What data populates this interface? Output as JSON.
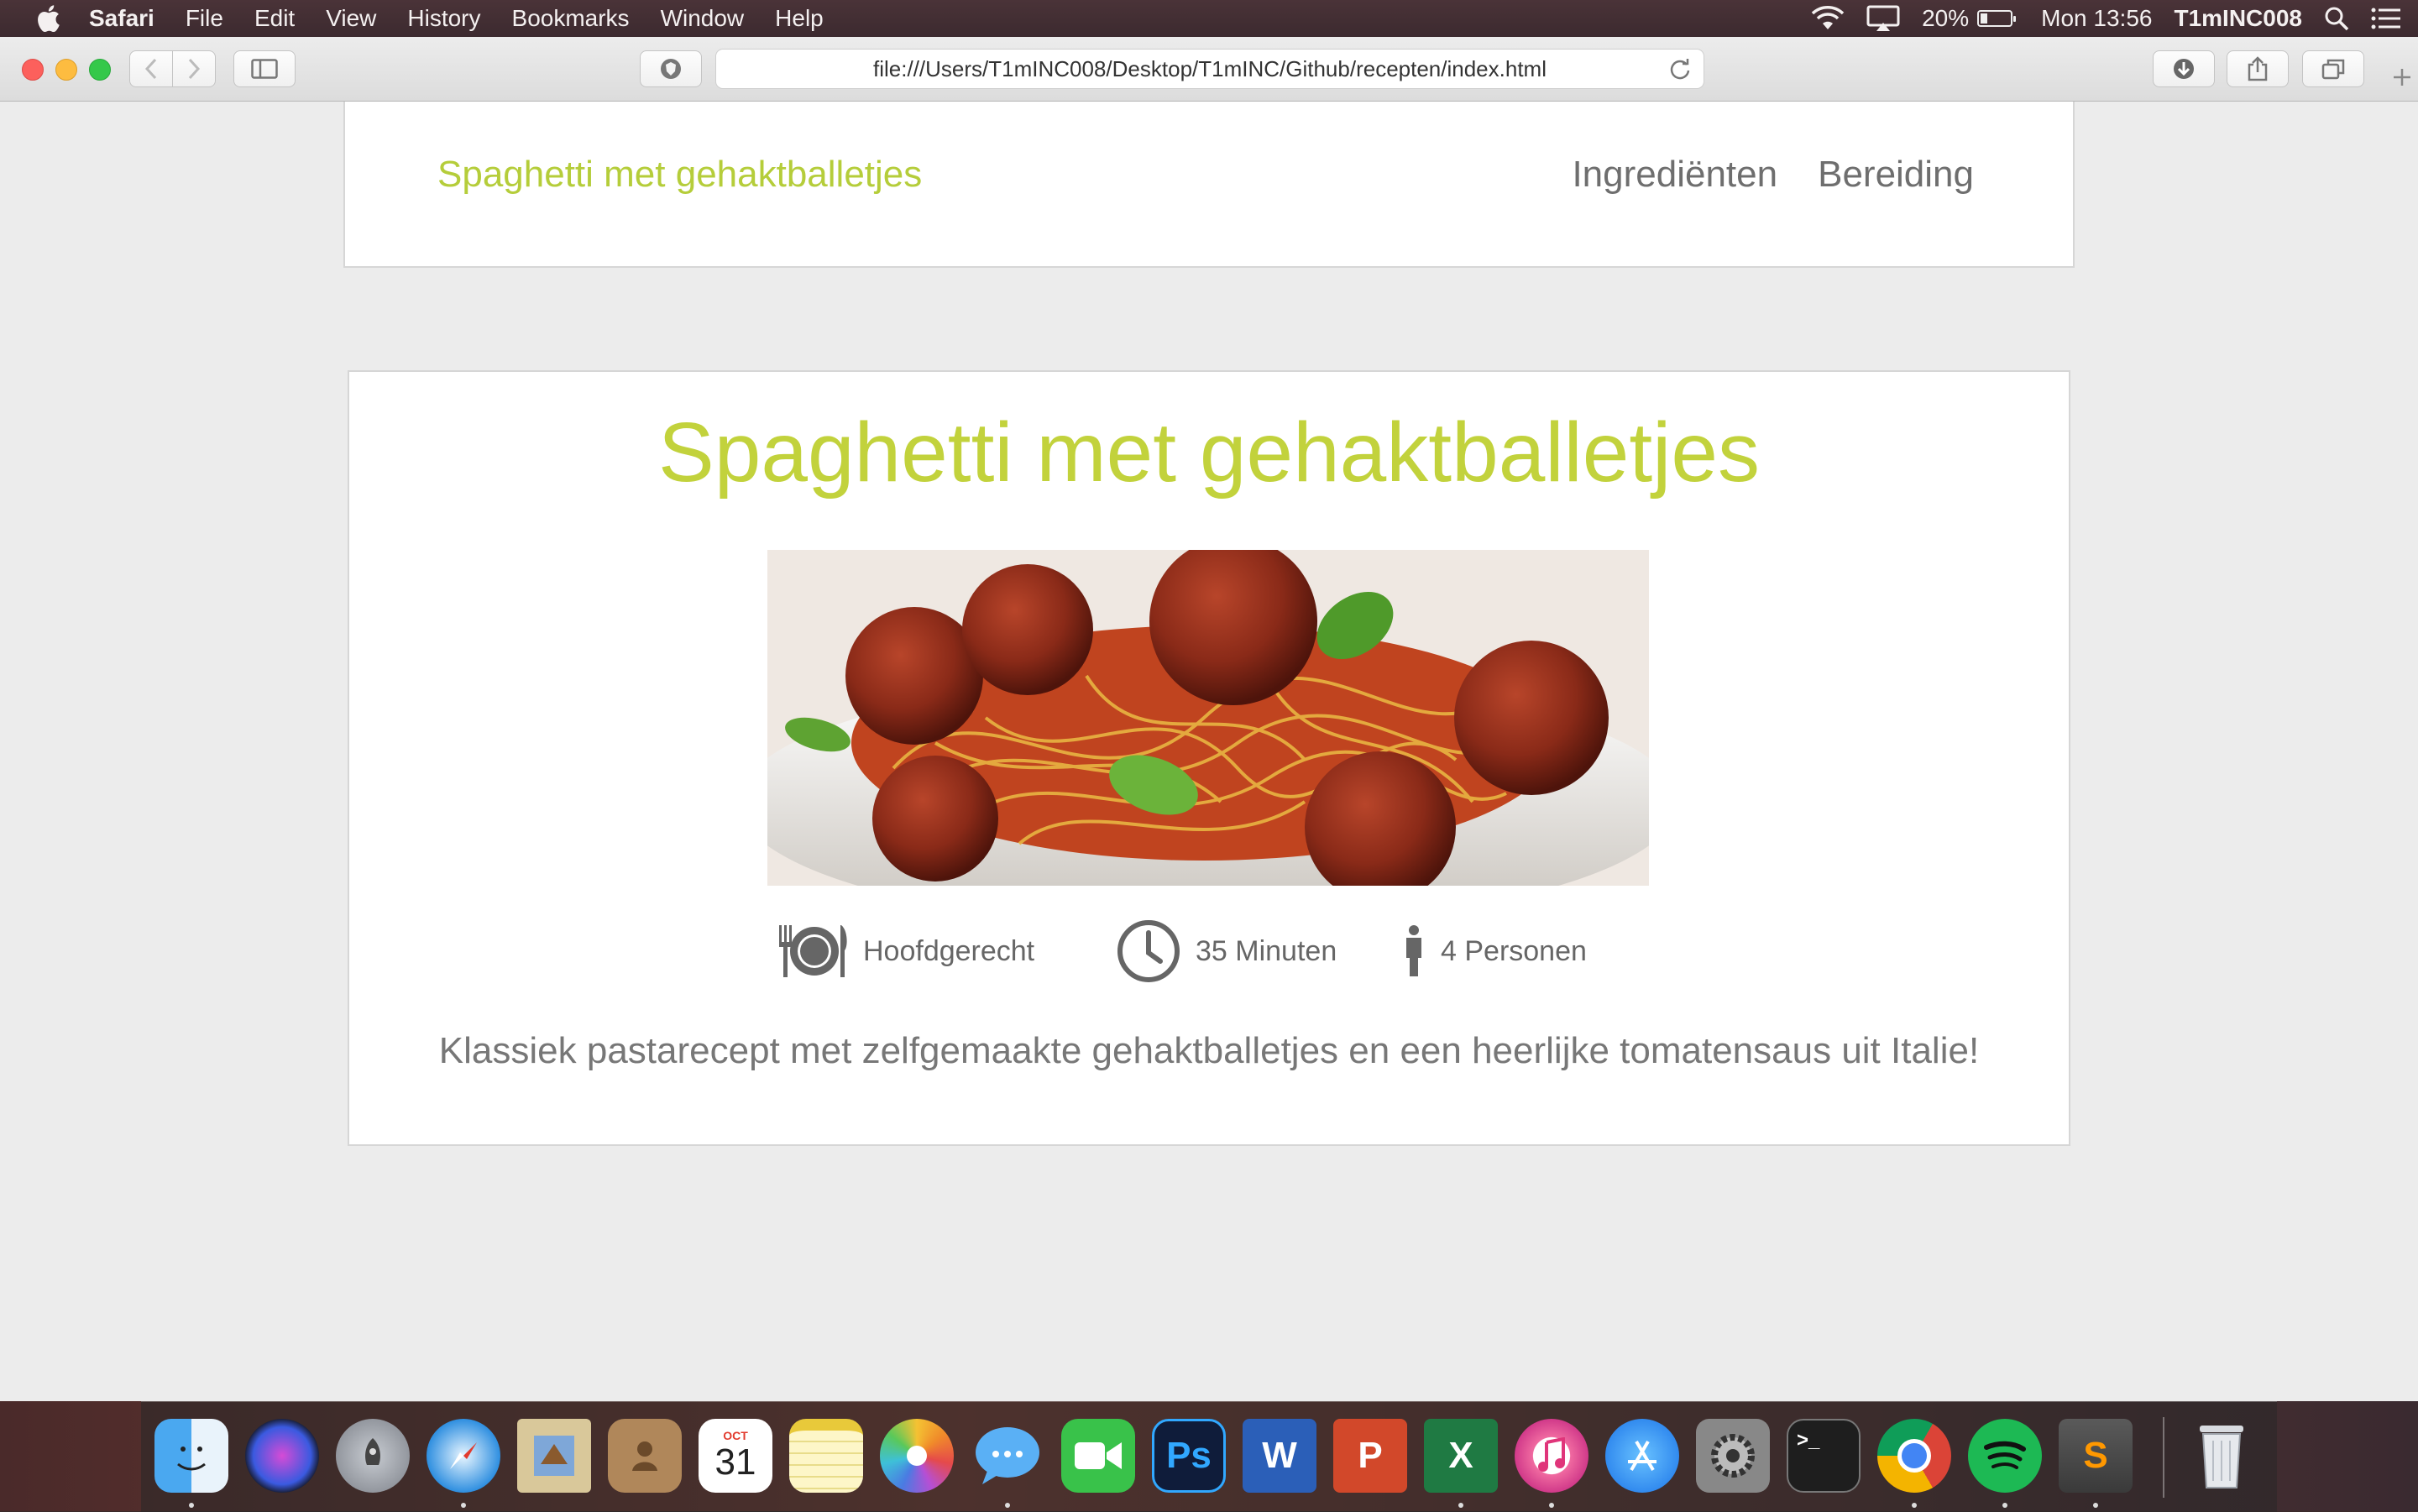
{
  "menubar": {
    "app_name": "Safari",
    "menus": [
      "File",
      "Edit",
      "View",
      "History",
      "Bookmarks",
      "Window",
      "Help"
    ],
    "battery": "20%",
    "clock": "Mon 13:56",
    "user": "T1mINC008"
  },
  "browser": {
    "url": "file:///Users/T1mINC008/Desktop/T1mINC/Github/recepten/index.html"
  },
  "site": {
    "brand": "Spaghetti met gehaktballetjes",
    "nav": [
      "Ingrediënten",
      "Bereiding"
    ]
  },
  "recipe": {
    "title": "Spaghetti met gehaktballetjes",
    "course": "Hoofdgerecht",
    "time": "35 Minuten",
    "servings": "4 Personen",
    "description": "Klassiek pastarecept met zelfgemaakte gehaktballetjes en een heerlijke tomatensaus uit Italie!",
    "title_color": "#c2d23c"
  },
  "dock": {
    "calendar_month": "OCT",
    "calendar_day": "31",
    "apps": [
      "finder-icon",
      "siri-icon",
      "launchpad-icon",
      "safari-icon",
      "mail-icon",
      "contacts-icon",
      "calendar-icon",
      "notes-icon",
      "photos-icon",
      "messages-icon",
      "facetime-icon",
      "photoshop-icon",
      "word-icon",
      "powerpoint-icon",
      "excel-icon",
      "itunes-icon",
      "app-store-icon",
      "system-preferences-icon",
      "terminal-icon",
      "chrome-icon",
      "spotify-icon",
      "sublime-text-icon",
      "trash-icon"
    ],
    "photoshop_label": "Ps",
    "word_label": "W",
    "powerpoint_label": "P",
    "excel_label": "X",
    "sublime_label": "S",
    "terminal_label": ">_"
  }
}
